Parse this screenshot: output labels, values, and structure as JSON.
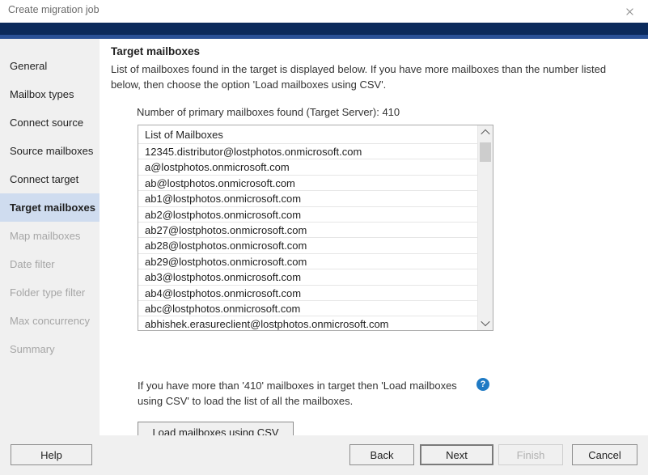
{
  "window": {
    "title": "Create migration job",
    "close_icon": "close-icon"
  },
  "sidebar": {
    "items": [
      {
        "label": "General",
        "state": "enabled"
      },
      {
        "label": "Mailbox types",
        "state": "enabled"
      },
      {
        "label": "Connect source",
        "state": "enabled"
      },
      {
        "label": "Source mailboxes",
        "state": "enabled"
      },
      {
        "label": "Connect target",
        "state": "enabled"
      },
      {
        "label": "Target mailboxes",
        "state": "active"
      },
      {
        "label": "Map mailboxes",
        "state": "disabled"
      },
      {
        "label": "Date filter",
        "state": "disabled"
      },
      {
        "label": "Folder type filter",
        "state": "disabled"
      },
      {
        "label": "Max concurrency",
        "state": "disabled"
      },
      {
        "label": "Summary",
        "state": "disabled"
      }
    ]
  },
  "main": {
    "title": "Target mailboxes",
    "description": "List of mailboxes found in the target is displayed below. If you have more mailboxes than the number listed below, then choose the option 'Load mailboxes using CSV'.",
    "count_line": "Number of primary mailboxes found (Target Server): 410",
    "list": {
      "header": "List of Mailboxes",
      "rows": [
        "12345.distributor@lostphotos.onmicrosoft.com",
        "a@lostphotos.onmicrosoft.com",
        "ab@lostphotos.onmicrosoft.com",
        "ab1@lostphotos.onmicrosoft.com",
        "ab2@lostphotos.onmicrosoft.com",
        "ab27@lostphotos.onmicrosoft.com",
        "ab28@lostphotos.onmicrosoft.com",
        "ab29@lostphotos.onmicrosoft.com",
        "ab3@lostphotos.onmicrosoft.com",
        "ab4@lostphotos.onmicrosoft.com",
        "abc@lostphotos.onmicrosoft.com",
        "abhishek.erasureclient@lostphotos.onmicrosoft.com"
      ],
      "scroll_up_icon": "chevron-up-icon",
      "scroll_down_icon": "chevron-down-icon"
    },
    "hint": "If you have more than '410' mailboxes in target then 'Load mailboxes using CSV' to load the list of all the mailboxes.",
    "help_icon_label": "?",
    "csv_button": "Load mailboxes using CSV"
  },
  "footer": {
    "help": "Help",
    "back": "Back",
    "next": "Next",
    "finish": "Finish",
    "cancel": "Cancel"
  },
  "colors": {
    "band_dark": "#0b2a5b",
    "band_light": "#2a5196",
    "sidebar_active": "#cfdcef",
    "help_icon": "#1f7ac4",
    "chrome": "#f0f0f0"
  }
}
